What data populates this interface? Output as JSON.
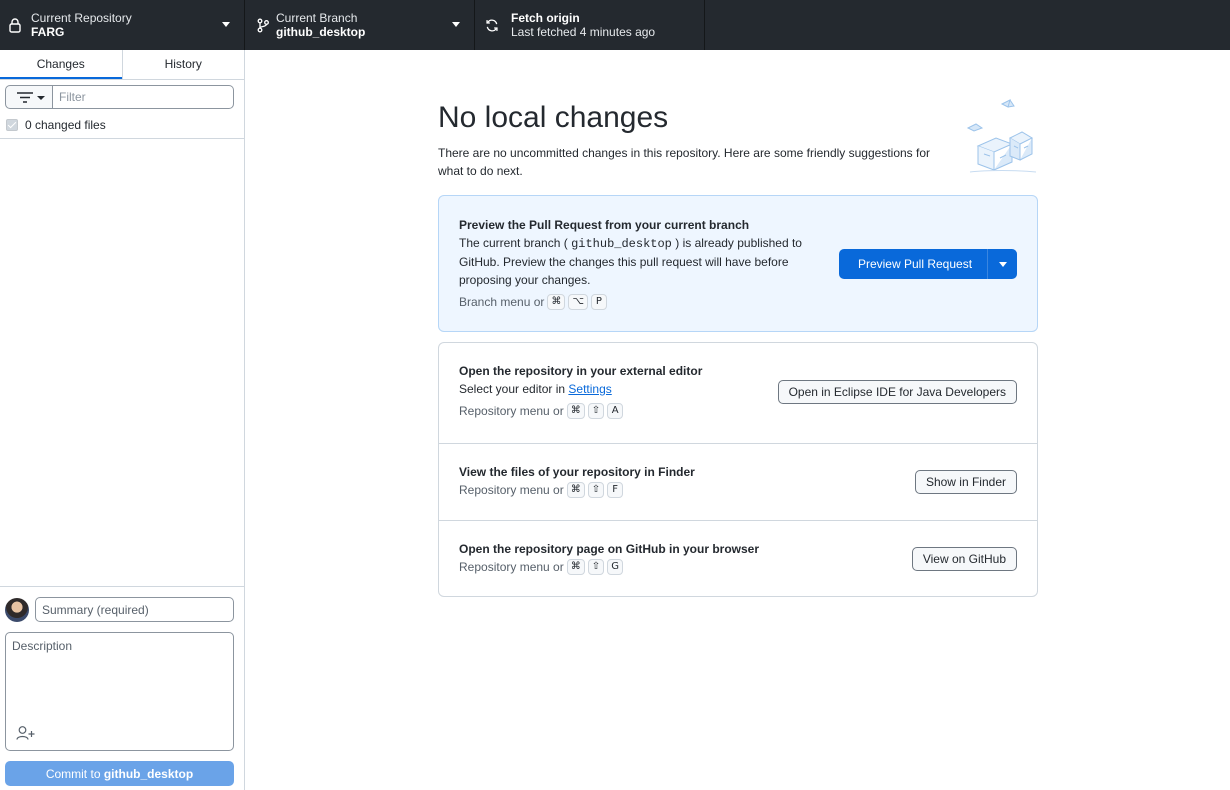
{
  "toolbar": {
    "repo": {
      "label": "Current Repository",
      "value": "FARG",
      "icon": "lock-icon"
    },
    "branch": {
      "label": "Current Branch",
      "value": "github_desktop",
      "icon": "git-branch-icon"
    },
    "fetch": {
      "label": "Fetch origin",
      "value": "Last fetched 4 minutes ago",
      "icon": "sync-icon"
    }
  },
  "sidebar": {
    "tabs": [
      {
        "label": "Changes",
        "active": true
      },
      {
        "label": "History",
        "active": false
      }
    ],
    "filter_placeholder": "Filter",
    "changed_files_label": "0 changed files",
    "commit": {
      "summary_placeholder": "Summary (required)",
      "description_placeholder": "Description",
      "button_prefix": "Commit to",
      "button_branch": "github_desktop"
    }
  },
  "main": {
    "title": "No local changes",
    "subtitle": "There are no uncommitted changes in this repository. Here are some friendly suggestions for what to do next.",
    "pull_request": {
      "title": "Preview the Pull Request from your current branch",
      "desc_before": "The current branch (",
      "desc_code": "github_desktop",
      "desc_after": ") is already published to GitHub. Preview the changes this pull request will have before proposing your changes.",
      "hint": "Branch menu or",
      "keys": [
        "⌘",
        "⌥",
        "P"
      ],
      "button": "Preview Pull Request"
    },
    "editor": {
      "title": "Open the repository in your external editor",
      "desc": "Select your editor in",
      "link": "Settings",
      "hint": "Repository menu or",
      "keys": [
        "⌘",
        "⇧",
        "A"
      ],
      "button": "Open in Eclipse IDE for Java Developers"
    },
    "finder": {
      "title": "View the files of your repository in Finder",
      "hint": "Repository menu or",
      "keys": [
        "⌘",
        "⇧",
        "F"
      ],
      "button": "Show in Finder"
    },
    "github": {
      "title": "Open the repository page on GitHub in your browser",
      "hint": "Repository menu or",
      "keys": [
        "⌘",
        "⇧",
        "G"
      ],
      "button": "View on GitHub"
    }
  },
  "colors": {
    "toolbar_bg": "#24292f",
    "accent": "#0969da",
    "highlight_bg": "#eef6ff"
  }
}
